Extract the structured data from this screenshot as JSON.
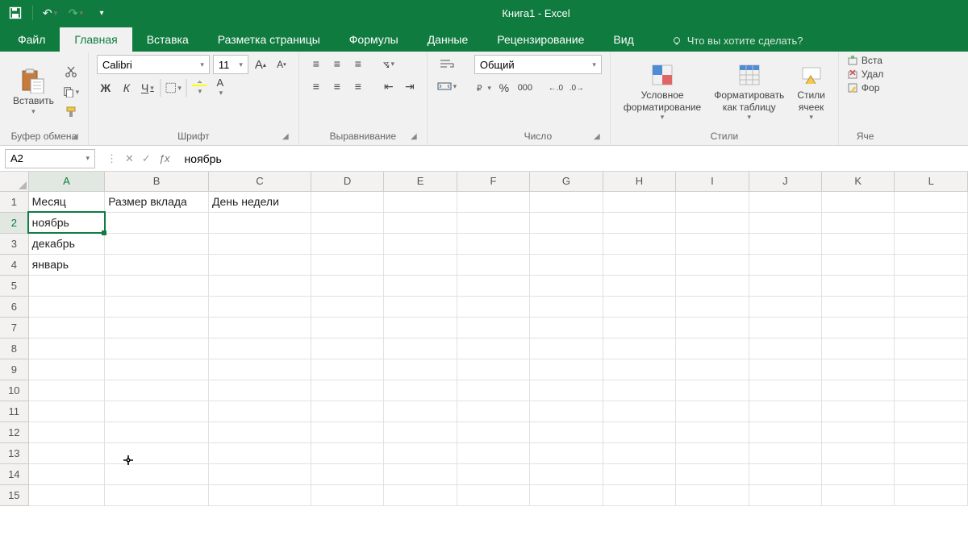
{
  "title": "Книга1 - Excel",
  "tabs": [
    "Файл",
    "Главная",
    "Вставка",
    "Разметка страницы",
    "Формулы",
    "Данные",
    "Рецензирование",
    "Вид"
  ],
  "active_tab": "Главная",
  "tellme_placeholder": "Что вы хотите сделать?",
  "ribbon": {
    "clipboard": {
      "paste": "Вставить",
      "group_label": "Буфер обмена"
    },
    "font": {
      "name": "Calibri",
      "size": "11",
      "group_label": "Шрифт"
    },
    "alignment": {
      "group_label": "Выравнивание"
    },
    "number": {
      "format": "Общий",
      "group_label": "Число"
    },
    "styles": {
      "cond_fmt": "Условное\nформатирование",
      "fmt_table": "Форматировать\nкак таблицу",
      "cell_styles": "Стили\nячеек",
      "group_label": "Стили"
    },
    "cells": {
      "insert": "Вста",
      "delete": "Удал",
      "format": "Фор",
      "group_label": "Яче"
    }
  },
  "namebox": "A2",
  "formula_value": "ноябрь",
  "columns": [
    "A",
    "B",
    "C",
    "D",
    "E",
    "F",
    "G",
    "H",
    "I",
    "J",
    "K",
    "L"
  ],
  "rows": [
    "1",
    "2",
    "3",
    "4",
    "5",
    "6",
    "7",
    "8",
    "9",
    "10",
    "11",
    "12",
    "13",
    "14",
    "15"
  ],
  "cells": {
    "A1": "Месяц",
    "B1": "Размер вклада",
    "C1": "День недели",
    "A2": "ноябрь",
    "A3": "декабрь",
    "A4": "январь"
  },
  "selected_cell": "A2",
  "active_col": "A",
  "active_row": "2"
}
